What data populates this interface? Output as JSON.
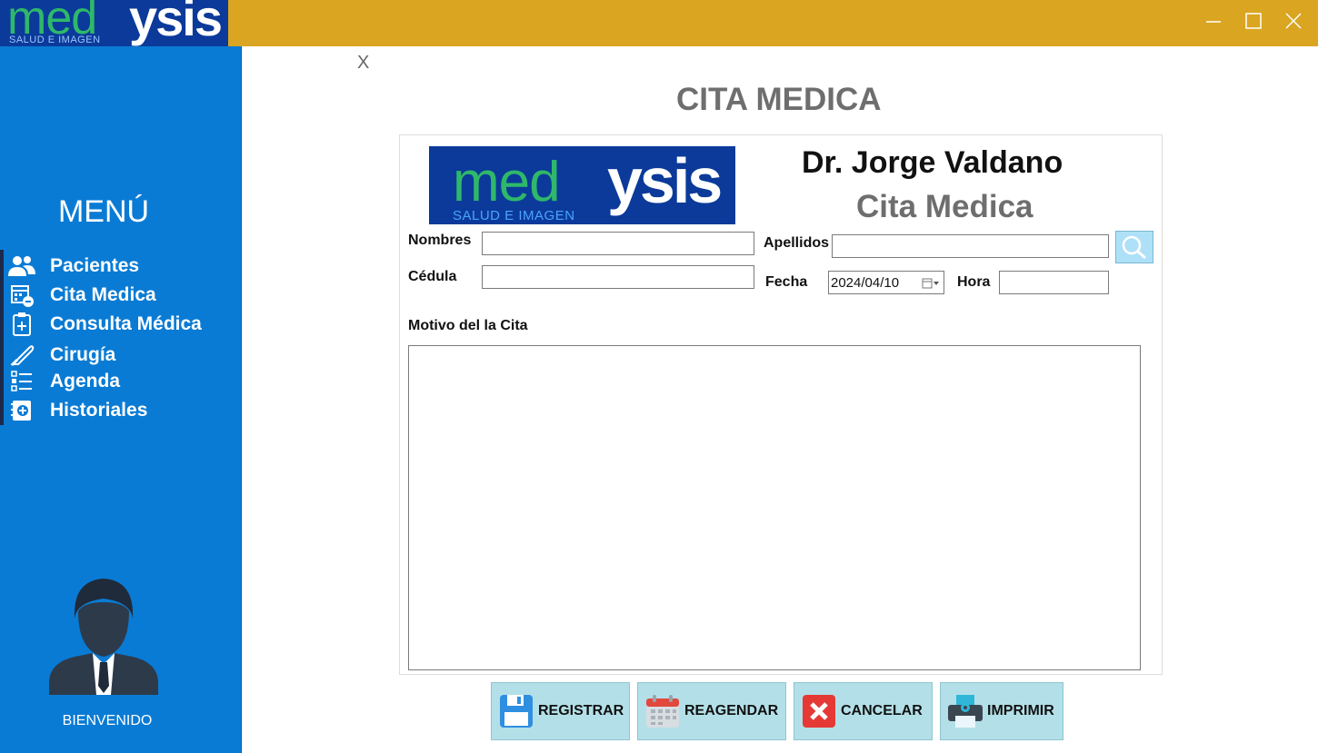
{
  "app": {
    "logo": {
      "brand_left": "med",
      "brand_right": "ysis",
      "tagline": "SALUD E IMAGEN"
    },
    "titlebar_color": "#DAA520"
  },
  "sidebar": {
    "title": "MENÚ",
    "items": [
      {
        "label": "Pacientes",
        "icon": "patients-icon"
      },
      {
        "label": "Cita Medica",
        "icon": "calendar-minus-icon"
      },
      {
        "label": "Consulta Médica",
        "icon": "clipboard-plus-icon"
      },
      {
        "label": "Cirugía",
        "icon": "scalpel-icon"
      },
      {
        "label": "Agenda",
        "icon": "list-icon"
      },
      {
        "label": "Historiales",
        "icon": "medical-record-icon"
      }
    ],
    "welcome": "BIENVENIDO",
    "color": "#0A7BD4"
  },
  "main": {
    "close_label": "X",
    "page_title": "CITA MEDICA",
    "doctor_name": "Dr. Jorge Valdano",
    "subtitle": "Cita Medica",
    "form": {
      "nombres_label": "Nombres",
      "nombres_value": "",
      "apellidos_label": "Apellidos",
      "apellidos_value": "",
      "cedula_label": "Cédula",
      "cedula_value": "",
      "fecha_label": "Fecha",
      "fecha_value": "2024/04/10",
      "hora_label": "Hora",
      "hora_value": "",
      "motivo_label": "Motivo del la Cita",
      "motivo_value": ""
    },
    "actions": {
      "registrar": "REGISTRAR",
      "reagendar": "REAGENDAR",
      "cancelar": "CANCELAR",
      "imprimir": "IMPRIMIR"
    }
  }
}
